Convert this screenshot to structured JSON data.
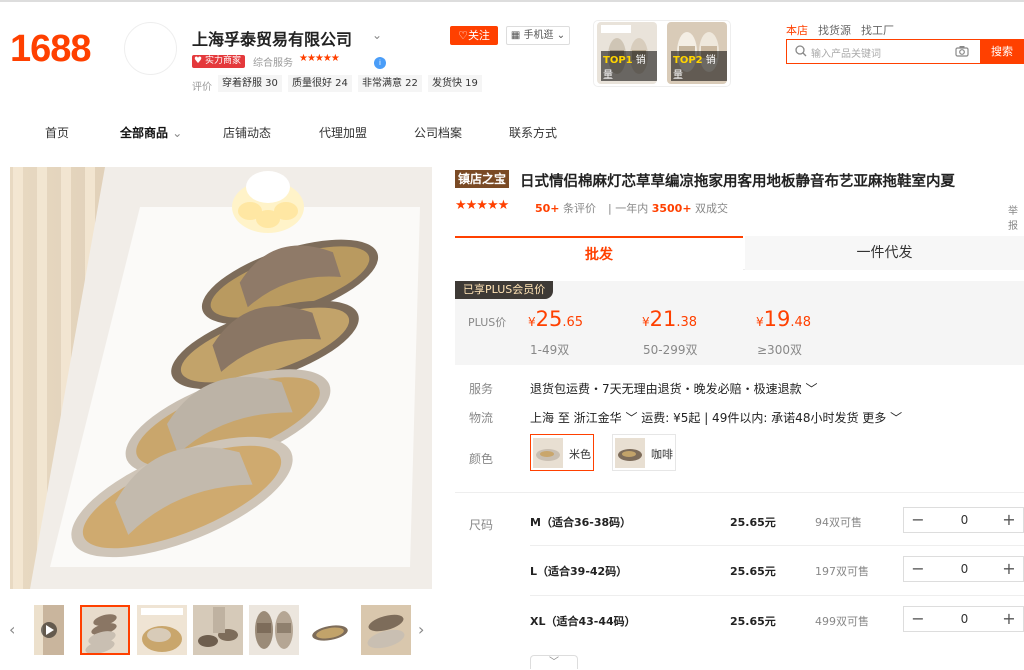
{
  "header": {
    "logo": "1688",
    "shop_name": "上海孚泰贸易有限公司",
    "power_badge": "实力商家",
    "service_label": "综合服务",
    "service_stars": "★★★★★",
    "eval_label": "评价",
    "eval_tags": [
      "穿着舒服 30",
      "质量很好 24",
      "非常满意 22",
      "发货快 19"
    ],
    "follow_label": "关注",
    "mobile_label": "手机逛",
    "top_items": [
      {
        "rank": "TOP1",
        "text": "销量"
      },
      {
        "rank": "TOP2",
        "text": "销量"
      }
    ],
    "search_tabs": [
      "本店",
      "找货源",
      "找工厂"
    ],
    "search_placeholder": "输入产品关键词",
    "search_button": "搜索"
  },
  "nav": [
    "首页",
    "全部商品",
    "店铺动态",
    "代理加盟",
    "公司档案",
    "联系方式"
  ],
  "product": {
    "title_badge": "镇店之宝",
    "title": "日式情侣棉麻灯芯草草编凉拖家用客用地板静音布艺亚麻拖鞋室内夏",
    "stars": "★★★★★",
    "reviews_count": "50+",
    "reviews_label": "条评价",
    "deals_prefix": "一年内",
    "deals_count": "3500+",
    "deals_suffix": "双成交",
    "report": "举报",
    "tabs": [
      "批发",
      "一件代发"
    ],
    "plus_badge": "已享PLUS会员价",
    "plus_label": "PLUS价",
    "tiers": [
      {
        "cur": "¥",
        "int": "25",
        "dec": ".65",
        "range": "1-49双"
      },
      {
        "cur": "¥",
        "int": "21",
        "dec": ".38",
        "range": "50-299双"
      },
      {
        "cur": "¥",
        "int": "19",
        "dec": ".48",
        "range": "≥300双"
      }
    ],
    "service_label": "服务",
    "service_text": "退货包运费・7天无理由退货・晚发必赔・极速退款 ﹀",
    "logistics_label": "物流",
    "logistics_text": "上海 至 浙江金华 ﹀  运费: ¥5起  |  49件以内: 承诺48小时发货  更多 ﹀",
    "color_label": "颜色",
    "colors": [
      "米色",
      "咖啡"
    ],
    "size_label": "尺码",
    "sizes": [
      {
        "name": "M（适合36-38码）",
        "price": "25.65元",
        "stock": "94双可售",
        "qty": "0"
      },
      {
        "name": "L（适合39-42码）",
        "price": "25.65元",
        "stock": "197双可售",
        "qty": "0"
      },
      {
        "name": "XL（适合43-44码）",
        "price": "25.65元",
        "stock": "499双可售",
        "qty": "0"
      }
    ]
  },
  "colors": {
    "accent": "#ff4000",
    "badge_brown": "#7a4a25",
    "plus_dark": "#3e3a36"
  }
}
